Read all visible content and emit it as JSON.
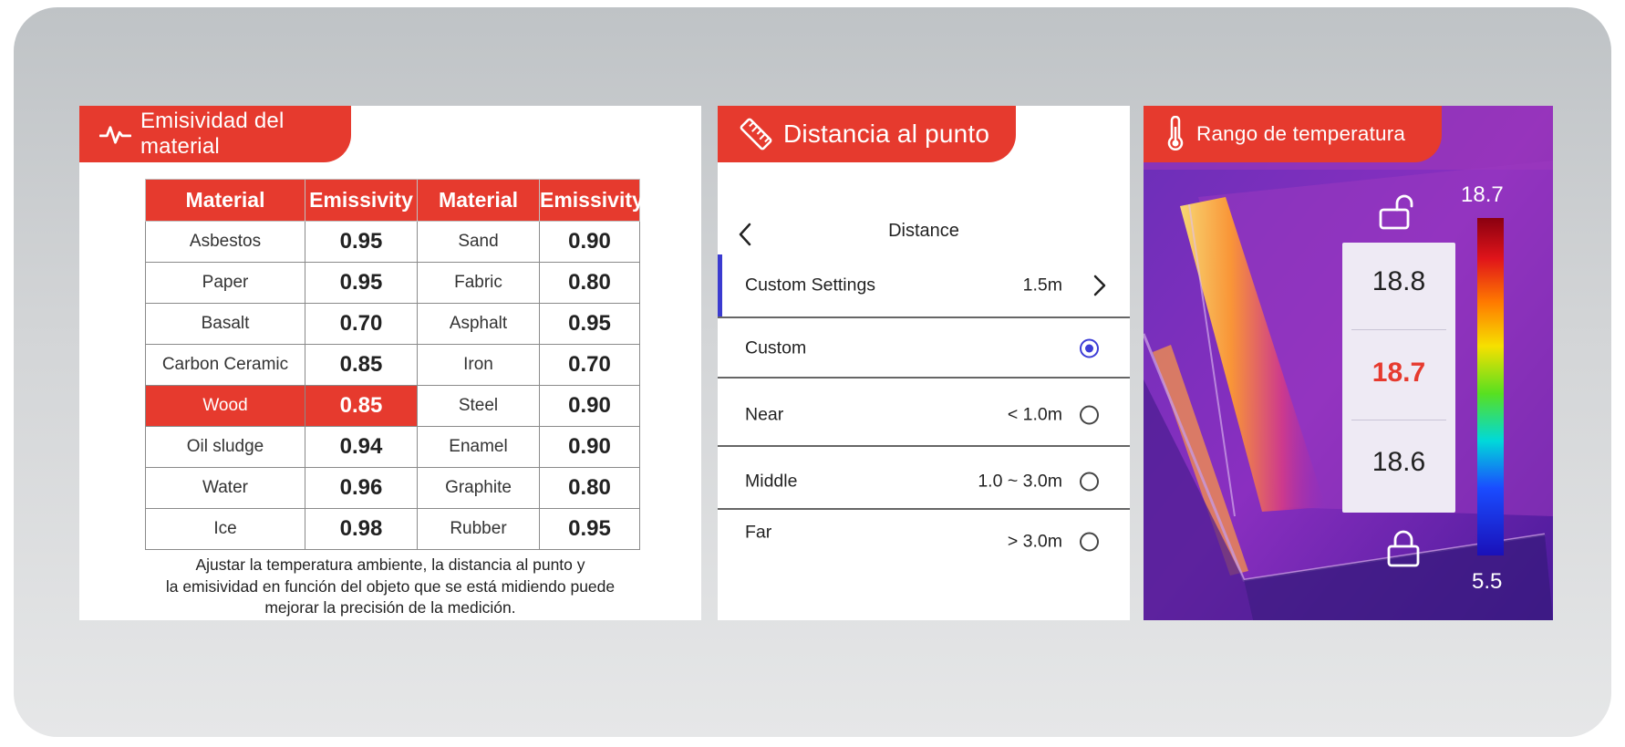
{
  "emissivity_panel": {
    "tab_title": "Emisividad del material",
    "headers": [
      "Material",
      "Emissivity",
      "Material",
      "Emissivity"
    ],
    "rows": [
      {
        "m1": "Asbestos",
        "e1": "0.95",
        "m2": "Sand",
        "e2": "0.90"
      },
      {
        "m1": "Paper",
        "e1": "0.95",
        "m2": "Fabric",
        "e2": "0.80"
      },
      {
        "m1": "Basalt",
        "e1": "0.70",
        "m2": "Asphalt",
        "e2": "0.95"
      },
      {
        "m1": "Carbon Ceramic",
        "e1": "0.85",
        "m2": "Iron",
        "e2": "0.70"
      },
      {
        "m1": "Wood",
        "e1": "0.85",
        "m2": "Steel",
        "e2": "0.90"
      },
      {
        "m1": "Oil sludge",
        "e1": "0.94",
        "m2": "Enamel",
        "e2": "0.90"
      },
      {
        "m1": "Water",
        "e1": "0.96",
        "m2": "Graphite",
        "e2": "0.80"
      },
      {
        "m1": "Ice",
        "e1": "0.98",
        "m2": "Rubber",
        "e2": "0.95"
      }
    ],
    "highlighted_row": "Wood",
    "caption_lines": [
      "Ajustar la temperatura ambiente, la distancia al punto y",
      "la emisividad en función del objeto que se está midiendo puede",
      "mejorar la precisión de la medición."
    ]
  },
  "distance_panel": {
    "tab_title": "Distancia al punto",
    "screen_title": "Distance",
    "custom_settings": {
      "label": "Custom Settings",
      "value": "1.5m"
    },
    "options": [
      {
        "label": "Custom",
        "value": "",
        "selected": true
      },
      {
        "label": "Near",
        "value": "< 1.0m",
        "selected": false
      },
      {
        "label": "Middle",
        "value": "1.0 ~ 3.0m",
        "selected": false
      },
      {
        "label": "Far",
        "value": "> 3.0m",
        "selected": false
      }
    ]
  },
  "temperature_panel": {
    "tab_title": "Rango de temperatura",
    "picker_values": [
      "18.8",
      "18.7",
      "18.6"
    ],
    "selected_value": "18.7",
    "scale_max": "18.7",
    "scale_min": "5.5"
  },
  "colors": {
    "accent_red": "#e63a2e",
    "radio_blue": "#3d3dd6"
  },
  "icons": [
    "activity-pulse-icon",
    "ruler-icon",
    "thermometer-icon",
    "chevron-left-icon",
    "chevron-right-icon",
    "unlock-icon",
    "lock-icon"
  ]
}
